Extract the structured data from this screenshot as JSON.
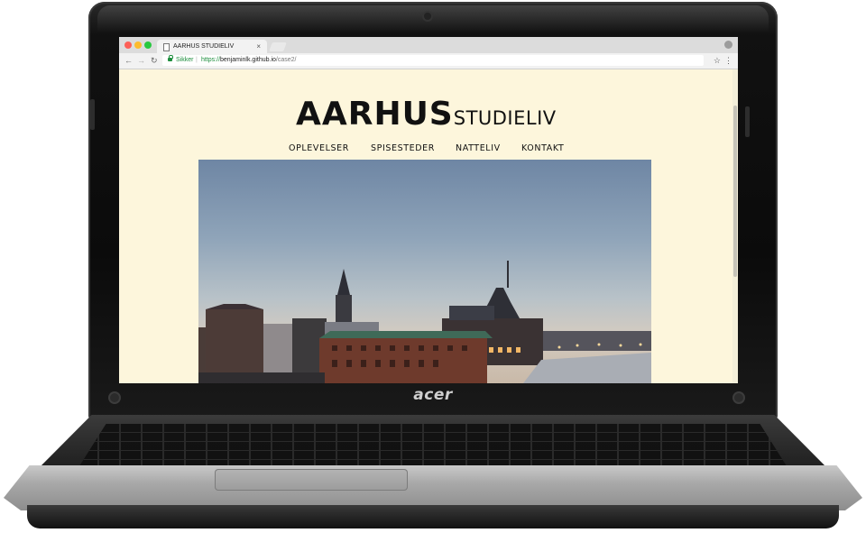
{
  "browser": {
    "tab_title": "AARHUS STUDIELIV",
    "tab_close": "×",
    "secure_label": "Sikker",
    "url_scheme": "https://",
    "url_host": "benjaminlk.github.io",
    "url_path": "/case2/",
    "icons": [
      "back-arrow-icon",
      "forward-arrow-icon",
      "reload-icon",
      "lock-icon",
      "star-icon",
      "menu-icon",
      "profile-icon",
      "document-icon"
    ]
  },
  "site": {
    "logo_big": "AARHUS",
    "logo_small": "STUDIELIV",
    "nav": [
      {
        "label": "OPLEVELSER"
      },
      {
        "label": "SPISESTEDER"
      },
      {
        "label": "NATTELIV"
      },
      {
        "label": "KONTAKT"
      }
    ],
    "hero_alt": "hero-photo"
  },
  "device": {
    "brand": "acer"
  },
  "colors": {
    "page_bg": "#fdf6dc",
    "text": "#111111",
    "secure_green": "#1e8e3e"
  }
}
